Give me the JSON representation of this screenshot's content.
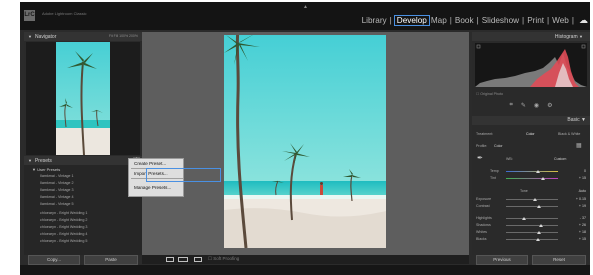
{
  "app": {
    "logo_text": "LrC",
    "catalog_title": "Adobe Lightroom Classic"
  },
  "modules": [
    {
      "label": "Library",
      "active": false
    },
    {
      "label": "Develop",
      "active": true
    },
    {
      "label": "Map",
      "active": false
    },
    {
      "label": "Book",
      "active": false
    },
    {
      "label": "Slideshow",
      "active": false
    },
    {
      "label": "Print",
      "active": false
    },
    {
      "label": "Web",
      "active": false
    }
  ],
  "left_panel": {
    "navigator_title": "Navigator",
    "navigator_zoom_options": "Fit   Fill   100%   200%",
    "presets_title": "Presets",
    "preset_folder": "User Presets",
    "presets": [
      "Ilamkmai - Vintage 1",
      "Ilamkmai - Vintage 2",
      "Ilamkmai - Vintage 3",
      "Ilamkmai - Vintage 4",
      "Ilamkmai - Vintage 5",
      "chloearyn - Bright Wedding 1",
      "chloearyn - Bright Wedding 2",
      "chloearyn - Bright Wedding 3",
      "chloearyn - Bright Wedding 4",
      "chloearyn - Bright Wedding 5"
    ],
    "copy_label": "Copy...",
    "paste_label": "Paste"
  },
  "context_menu": {
    "items": [
      "Create Preset...",
      "Import Presets...",
      "Manage Presets..."
    ],
    "highlighted": "Import Presets..."
  },
  "toolbar": {
    "soft_proofing_label": "Soft Proofing"
  },
  "right_panel": {
    "histogram_title": "Histogram",
    "original_photo_label": "Original Photo",
    "basic_title": "Basic",
    "treatment_label": "Treatment:",
    "color_label": "Color",
    "bw_label": "Black & White",
    "profile_label": "Profile:",
    "profile_value": "Color",
    "wb_label": "WB:",
    "wb_value": "Custom",
    "temp_label": "Temp",
    "temp_value": "0",
    "tint_label": "Tint",
    "tint_value": "+ 15",
    "tone_label": "Tone",
    "auto_label": "Auto",
    "exposure_label": "Exposure",
    "exposure_value": "+ 0.15",
    "contrast_label": "Contrast",
    "contrast_value": "+ 19",
    "highlights_label": "Highlights",
    "highlights_value": "- 37",
    "shadows_label": "Shadows",
    "shadows_value": "+ 26",
    "whites_label": "Whites",
    "whites_value": "+ 18",
    "blacks_label": "Blacks",
    "blacks_value": "+ 15",
    "previous_label": "Previous",
    "reset_label": "Reset"
  },
  "colors": {
    "accent": "#4a90e2",
    "panel_bg": "#2a2a2a",
    "canvas_bg": "#5e5e5e",
    "sky_top": "#4fd3d6",
    "sky_bottom": "#7fe0de"
  }
}
